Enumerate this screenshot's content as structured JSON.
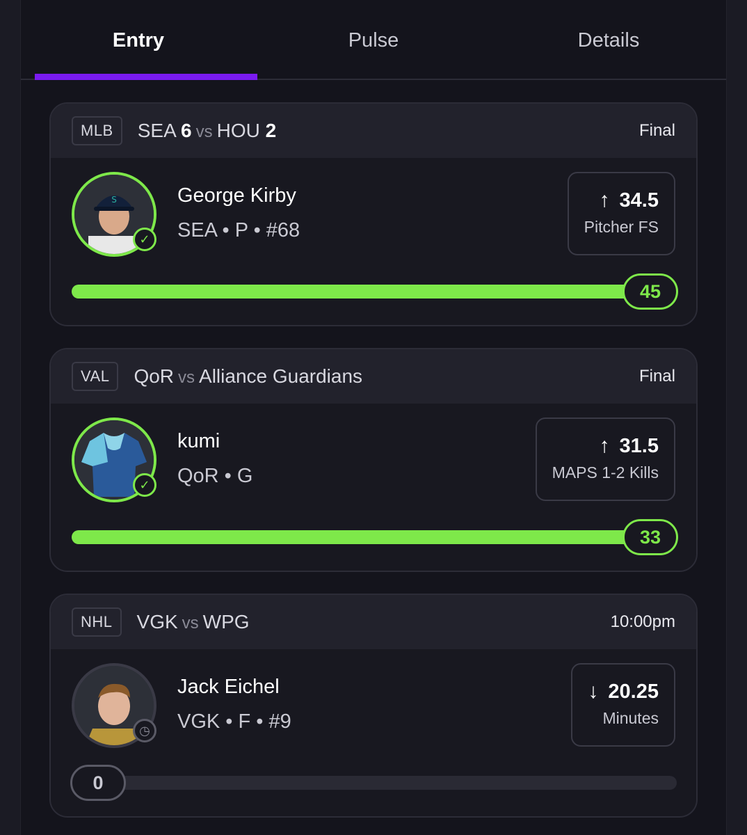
{
  "tabs": [
    {
      "label": "Entry",
      "active": true
    },
    {
      "label": "Pulse",
      "active": false
    },
    {
      "label": "Details",
      "active": false
    }
  ],
  "colors": {
    "accent": "#7a1bf0",
    "success": "#7ee84a"
  },
  "cards": [
    {
      "league": "MLB",
      "team1": "SEA",
      "score1": "6",
      "vs": "vs",
      "team2": "HOU",
      "score2": "2",
      "status": "Final",
      "player": "George Kirby",
      "meta": "SEA • P • #68",
      "direction": "up",
      "line": "34.5",
      "stat": "Pitcher FS",
      "progress_value": "45",
      "progress_fraction": 1.0,
      "badge_icon": "check-icon"
    },
    {
      "league": "VAL",
      "team1": "QoR",
      "score1": "",
      "vs": "vs",
      "team2": "Alliance Guardians",
      "score2": "",
      "status": "Final",
      "player": "kumi",
      "meta": "QoR • G",
      "direction": "up",
      "line": "31.5",
      "stat": "MAPS 1-2 Kills",
      "progress_value": "33",
      "progress_fraction": 1.0,
      "badge_icon": "check-icon"
    },
    {
      "league": "NHL",
      "team1": "VGK",
      "score1": "",
      "vs": "vs",
      "team2": "WPG",
      "score2": "",
      "status": "10:00pm",
      "player": "Jack Eichel",
      "meta": "VGK • F • #9",
      "direction": "down",
      "line": "20.25",
      "stat": "Minutes",
      "progress_value": "0",
      "progress_fraction": 0.0,
      "badge_icon": "clock-icon"
    }
  ]
}
